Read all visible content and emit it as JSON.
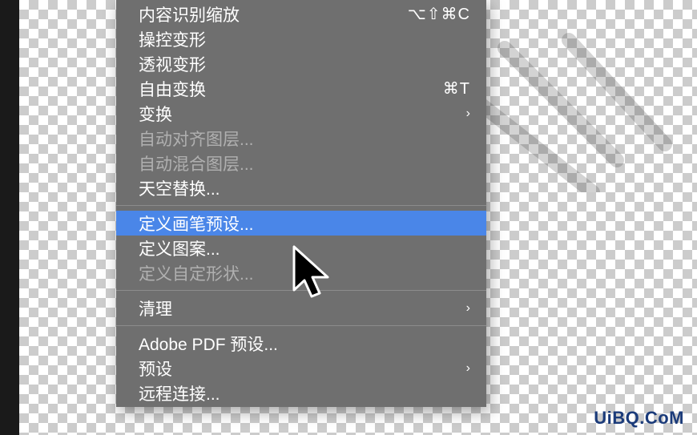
{
  "menu": {
    "sections": [
      {
        "items": [
          {
            "label": "内容识别缩放",
            "shortcut": "⌥⇧⌘C",
            "submenu": false,
            "disabled": false
          },
          {
            "label": "操控变形",
            "shortcut": "",
            "submenu": false,
            "disabled": false
          },
          {
            "label": "透视变形",
            "shortcut": "",
            "submenu": false,
            "disabled": false
          },
          {
            "label": "自由变换",
            "shortcut": "⌘T",
            "submenu": false,
            "disabled": false
          },
          {
            "label": "变换",
            "shortcut": "",
            "submenu": true,
            "disabled": false
          },
          {
            "label": "自动对齐图层...",
            "shortcut": "",
            "submenu": false,
            "disabled": true
          },
          {
            "label": "自动混合图层...",
            "shortcut": "",
            "submenu": false,
            "disabled": true
          },
          {
            "label": "天空替换...",
            "shortcut": "",
            "submenu": false,
            "disabled": false
          }
        ]
      },
      {
        "items": [
          {
            "label": "定义画笔预设...",
            "shortcut": "",
            "submenu": false,
            "disabled": false,
            "selected": true
          },
          {
            "label": "定义图案...",
            "shortcut": "",
            "submenu": false,
            "disabled": false
          },
          {
            "label": "定义自定形状...",
            "shortcut": "",
            "submenu": false,
            "disabled": true
          }
        ]
      },
      {
        "items": [
          {
            "label": "清理",
            "shortcut": "",
            "submenu": true,
            "disabled": false
          }
        ]
      },
      {
        "items": [
          {
            "label": "Adobe PDF 预设...",
            "shortcut": "",
            "submenu": false,
            "disabled": false
          },
          {
            "label": "预设",
            "shortcut": "",
            "submenu": true,
            "disabled": false
          },
          {
            "label": "远程连接...",
            "shortcut": "",
            "submenu": false,
            "disabled": false
          }
        ]
      }
    ]
  },
  "watermark_bottom": "UiBQ.CoM",
  "watermark_top": "",
  "submenu_arrow": "›"
}
